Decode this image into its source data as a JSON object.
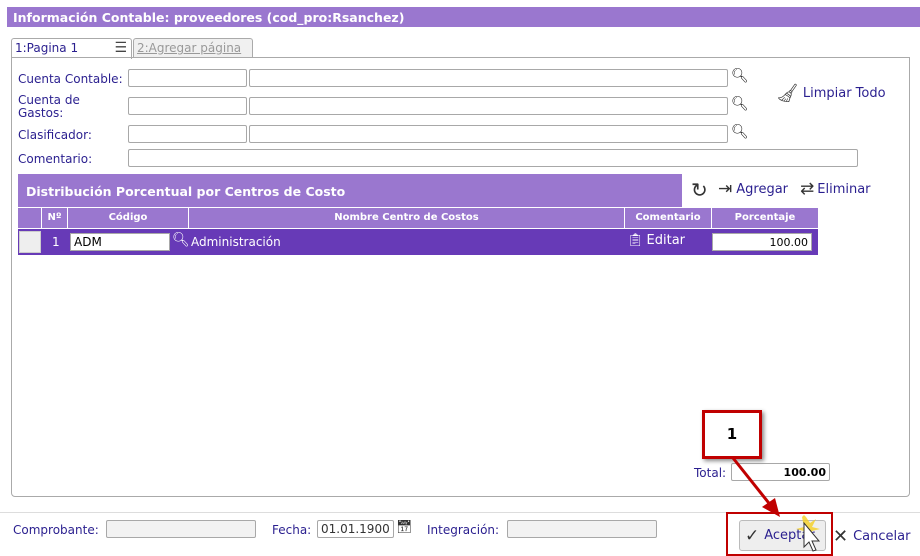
{
  "window": {
    "title": "Información Contable: proveedores (cod_pro:Rsanchez)"
  },
  "tabs": [
    {
      "label": "1:Pagina 1",
      "active": true
    },
    {
      "label": "2:Agregar página",
      "active": false
    }
  ],
  "form": {
    "cuenta_contable": {
      "label": "Cuenta Contable:",
      "code": "",
      "name": ""
    },
    "cuenta_gastos": {
      "label": "Cuenta de Gastos:",
      "code": "",
      "name": ""
    },
    "clasificador": {
      "label": "Clasificador:",
      "code": "",
      "name": ""
    },
    "comentario": {
      "label": "Comentario:",
      "value": ""
    },
    "limpiar_label": "Limpiar Todo"
  },
  "section": {
    "title": "Distribución Porcentual por Centros de Costo",
    "agregar_label": "Agregar",
    "eliminar_label": "Eliminar"
  },
  "table": {
    "columns": [
      "Nº",
      "Código",
      "Nombre Centro de Costos",
      "Comentario",
      "Porcentaje"
    ],
    "rows": [
      {
        "n": "1",
        "codigo": "ADM",
        "nombre": "Administración",
        "comentario": "Editar",
        "porcentaje": "100.00"
      }
    ]
  },
  "total": {
    "label": "Total:",
    "value": "100.00"
  },
  "footer": {
    "comprobante_label": "Comprobante:",
    "comprobante": "",
    "fecha_label": "Fecha:",
    "fecha": "01.01.1900",
    "integracion_label": "Integración:",
    "integracion": "",
    "aceptar_label": "Aceptar",
    "cancelar_label": "Cancelar"
  },
  "annotation": {
    "step": "1",
    "color": "#c00000"
  },
  "colors": {
    "header": "#9a77cf",
    "selected_row": "#673ab7",
    "label": "#2a1f8f"
  }
}
